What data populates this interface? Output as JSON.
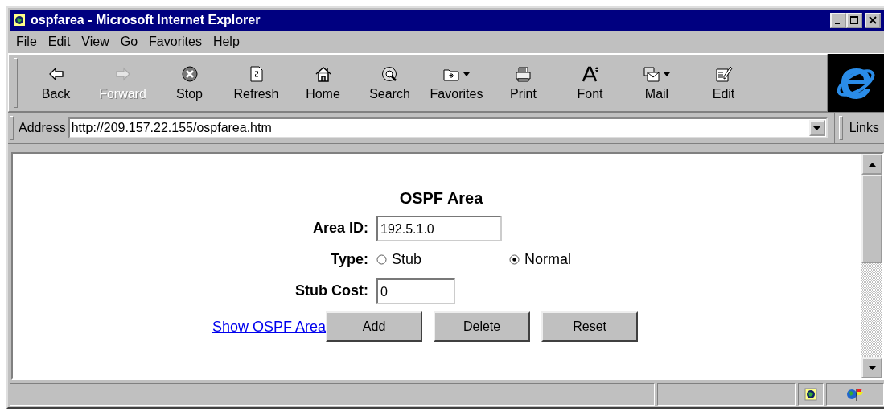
{
  "window": {
    "title": "ospfarea - Microsoft Internet Explorer"
  },
  "menu": [
    "File",
    "Edit",
    "View",
    "Go",
    "Favorites",
    "Help"
  ],
  "toolbar": [
    {
      "label": "Back",
      "disabled": false,
      "dropdown": false
    },
    {
      "label": "Forward",
      "disabled": true,
      "dropdown": false
    },
    {
      "label": "Stop",
      "disabled": false,
      "dropdown": false
    },
    {
      "label": "Refresh",
      "disabled": false,
      "dropdown": false
    },
    {
      "label": "Home",
      "disabled": false,
      "dropdown": false
    },
    {
      "label": "Search",
      "disabled": false,
      "dropdown": false
    },
    {
      "label": "Favorites",
      "disabled": false,
      "dropdown": true
    },
    {
      "label": "Print",
      "disabled": false,
      "dropdown": false
    },
    {
      "label": "Font",
      "disabled": false,
      "dropdown": false
    },
    {
      "label": "Mail",
      "disabled": false,
      "dropdown": true
    },
    {
      "label": "Edit",
      "disabled": false,
      "dropdown": false
    }
  ],
  "address_bar": {
    "label": "Address",
    "value": "http://209.157.22.155/ospfarea.htm",
    "links": "Links"
  },
  "page": {
    "title": "OSPF Area",
    "fields": [
      {
        "kind": "text",
        "label": "Area ID:",
        "value": "192.5.1.0"
      },
      {
        "kind": "radio",
        "label": "Type:",
        "options": [
          {
            "label": "Stub",
            "selected": false
          },
          {
            "label": "Normal",
            "selected": true
          }
        ]
      },
      {
        "kind": "text",
        "label": "Stub Cost:",
        "value": "0"
      }
    ],
    "link": "Show OSPF Area",
    "buttons": [
      "Add",
      "Delete",
      "Reset"
    ]
  }
}
